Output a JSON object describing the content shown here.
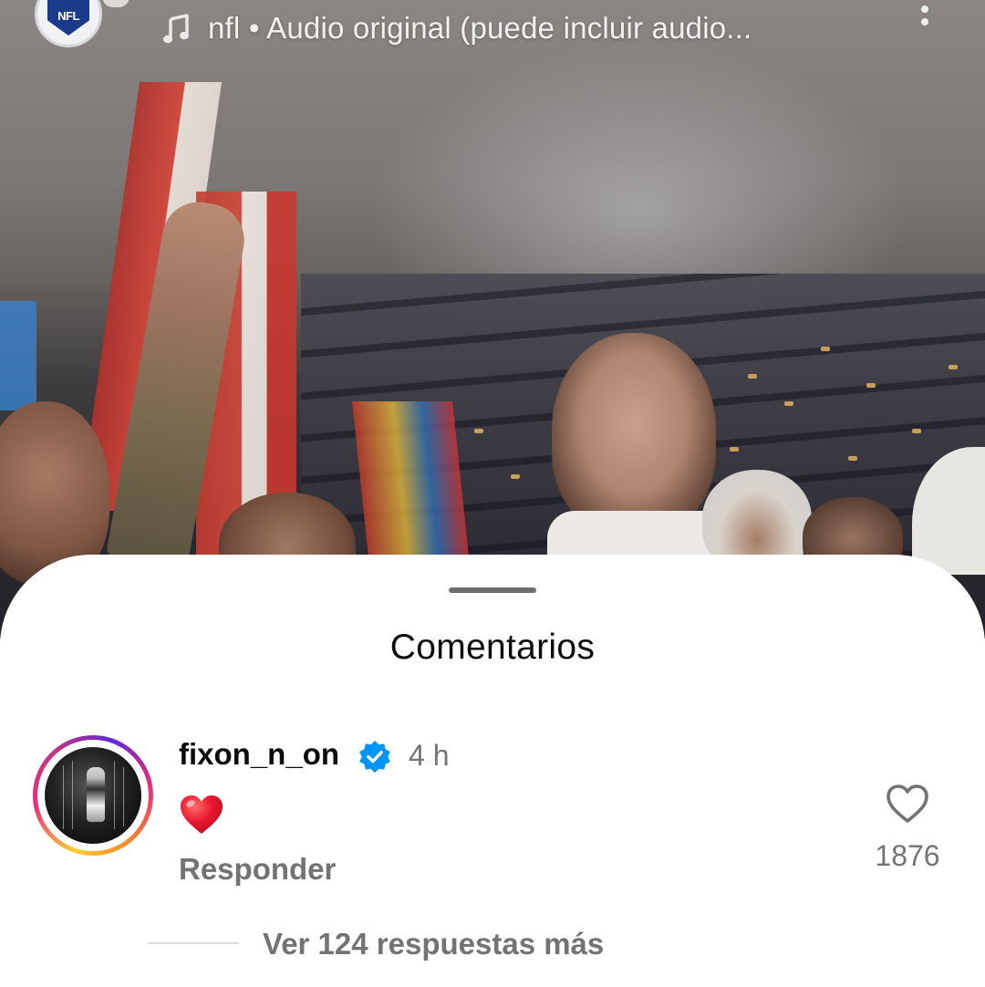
{
  "top_bar": {
    "account_logo_text": "NFL",
    "audio_label": "nfl • Audio original (puede incluir audio..."
  },
  "icons": {
    "music": "music-note-icon",
    "more": "more-vertical-icon",
    "verified": "verified-badge-icon",
    "like": "heart-outline-icon"
  },
  "comments_sheet": {
    "title": "Comentarios"
  },
  "comment": {
    "username": "fixon_n_on",
    "time": "4 h",
    "text": "❤️",
    "reply_label": "Responder",
    "like_count": "1876",
    "view_replies_label": "Ver 124 respuestas más"
  },
  "colors": {
    "verified_blue": "#0095f6",
    "secondary_text": "#737373",
    "heart_red": "#e0193a"
  }
}
